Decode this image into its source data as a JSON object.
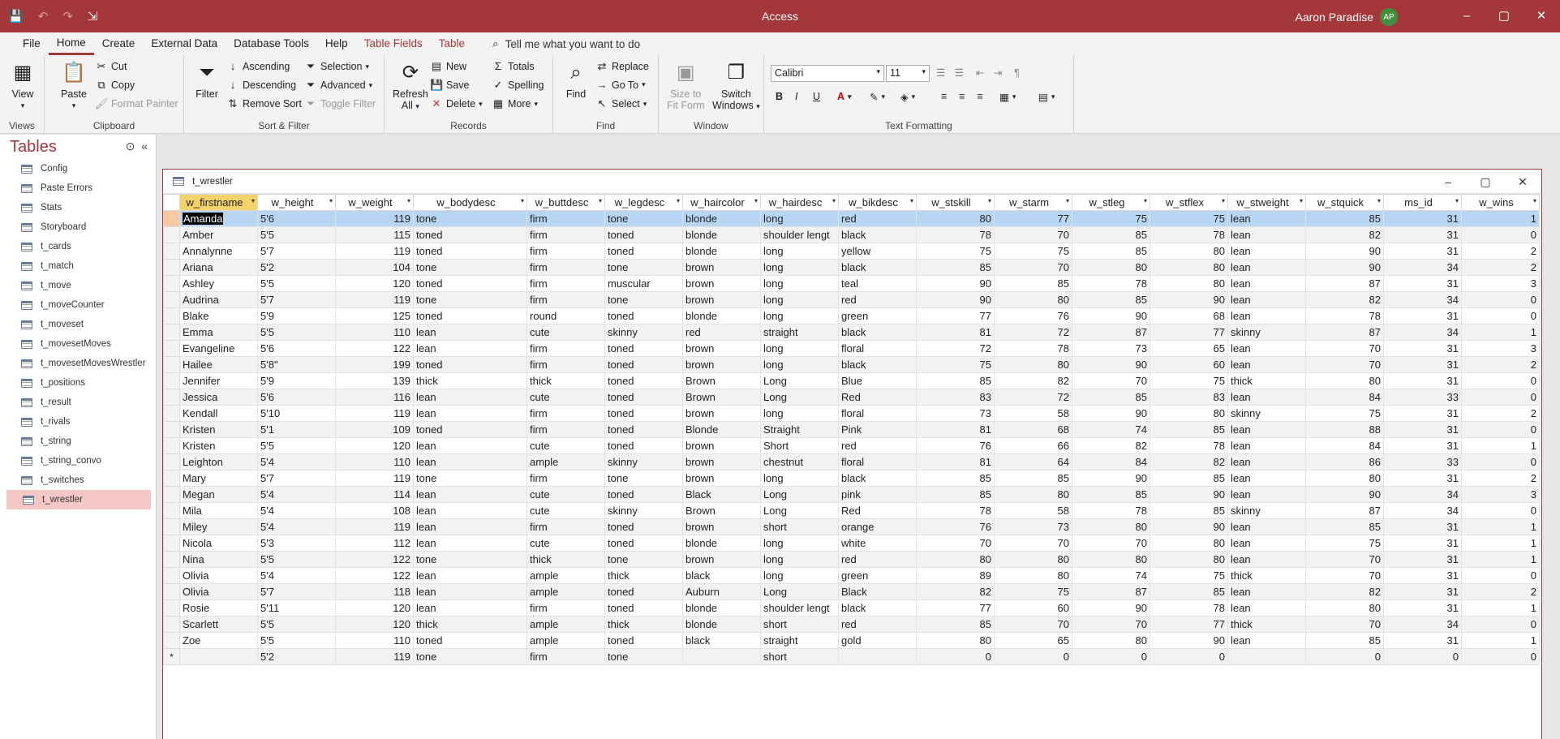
{
  "titlebar": {
    "qat": {
      "save": "💾",
      "undo": "↶",
      "redo": "↷",
      "customize": "⇲"
    },
    "title": "Access",
    "user": "Aaron Paradise",
    "initials": "AP",
    "controls": {
      "minimize": "–",
      "maximize": "▢",
      "close": "✕"
    }
  },
  "menu": {
    "tabs": [
      "File",
      "Home",
      "Create",
      "External Data",
      "Database Tools",
      "Help",
      "Table Fields",
      "Table"
    ],
    "active": "Home",
    "search_icon": "⌕",
    "search": "Tell me what you want to do"
  },
  "ribbon": {
    "views": {
      "view": "View",
      "label": "Views"
    },
    "clipboard": {
      "paste": "Paste",
      "cut": "Cut",
      "copy": "Copy",
      "format_painter": "Format Painter",
      "label": "Clipboard"
    },
    "sortfilter": {
      "filter": "Filter",
      "ascending": "Ascending",
      "descending": "Descending",
      "remove_sort": "Remove Sort",
      "selection": "Selection",
      "advanced": "Advanced",
      "toggle_filter": "Toggle Filter",
      "label": "Sort & Filter"
    },
    "records": {
      "refresh": "Refresh",
      "refresh2": "All",
      "new": "New",
      "save": "Save",
      "delete": "Delete",
      "totals": "Totals",
      "spelling": "Spelling",
      "more": "More",
      "label": "Records"
    },
    "find": {
      "find": "Find",
      "replace": "Replace",
      "goto": "Go To",
      "select": "Select",
      "label": "Find"
    },
    "window": {
      "size_to_fit": "Size to",
      "size_to_fit2": "Fit Form",
      "switch": "Switch",
      "switch2": "Windows",
      "label": "Window"
    },
    "text": {
      "font": "Calibri",
      "size": "11",
      "bold": "B",
      "italic": "I",
      "underline": "U",
      "label": "Text Formatting"
    }
  },
  "nav": {
    "title": "Tables",
    "items": [
      "Config",
      "Paste Errors",
      "Stats",
      "Storyboard",
      "t_cards",
      "t_match",
      "t_move",
      "t_moveCounter",
      "t_moveset",
      "t_movesetMoves",
      "t_movesetMovesWrestler",
      "t_positions",
      "t_result",
      "t_rivals",
      "t_string",
      "t_string_convo",
      "t_switches",
      "t_wrestler"
    ],
    "selected": "t_wrestler"
  },
  "doc": {
    "title": "t_wrestler",
    "columns": [
      "w_firstname",
      "w_height",
      "w_weight",
      "w_bodydesc",
      "w_buttdesc",
      "w_legdesc",
      "w_haircolor",
      "w_hairdesc",
      "w_bikdesc",
      "w_stskill",
      "w_starm",
      "w_stleg",
      "w_stflex",
      "w_stweight",
      "w_stquick",
      "ms_id",
      "w_wins"
    ],
    "rows": [
      [
        "Amanda",
        "5'6",
        "119",
        "tone",
        "firm",
        "tone",
        "blonde",
        "long",
        "red",
        "80",
        "77",
        "75",
        "75",
        "lean",
        "85",
        "31",
        "1"
      ],
      [
        "Amber",
        "5'5",
        "115",
        "toned",
        "firm",
        "toned",
        "blonde",
        "shoulder lengt",
        "black",
        "78",
        "70",
        "85",
        "78",
        "lean",
        "82",
        "31",
        "0"
      ],
      [
        "Annalynne",
        "5'7",
        "119",
        "toned",
        "firm",
        "toned",
        "blonde",
        "long",
        "yellow",
        "75",
        "75",
        "85",
        "80",
        "lean",
        "90",
        "31",
        "2"
      ],
      [
        "Ariana",
        "5'2",
        "104",
        "tone",
        "firm",
        "tone",
        "brown",
        "long",
        "black",
        "85",
        "70",
        "80",
        "80",
        "lean",
        "90",
        "34",
        "2"
      ],
      [
        "Ashley",
        "5'5",
        "120",
        "toned",
        "firm",
        "muscular",
        "brown",
        "long",
        "teal",
        "90",
        "85",
        "78",
        "80",
        "lean",
        "87",
        "31",
        "3"
      ],
      [
        "Audrina",
        "5'7",
        "119",
        "tone",
        "firm",
        "tone",
        "brown",
        "long",
        "red",
        "90",
        "80",
        "85",
        "90",
        "lean",
        "82",
        "34",
        "0"
      ],
      [
        "Blake",
        "5'9",
        "125",
        "toned",
        "round",
        "toned",
        "blonde",
        "long",
        "green",
        "77",
        "76",
        "90",
        "68",
        "lean",
        "78",
        "31",
        "0"
      ],
      [
        "Emma",
        "5'5",
        "110",
        "lean",
        "cute",
        "skinny",
        "red",
        "straight",
        "black",
        "81",
        "72",
        "87",
        "77",
        "skinny",
        "87",
        "34",
        "1"
      ],
      [
        "Evangeline",
        "5'6",
        "122",
        "lean",
        "firm",
        "toned",
        "brown",
        "long",
        "floral",
        "72",
        "78",
        "73",
        "65",
        "lean",
        "70",
        "31",
        "3"
      ],
      [
        "Hailee",
        "5'8\"",
        "199",
        "toned",
        "firm",
        "toned",
        "brown",
        "long",
        "black",
        "75",
        "80",
        "90",
        "60",
        "lean",
        "70",
        "31",
        "2"
      ],
      [
        "Jennifer",
        "5'9",
        "139",
        "thick",
        "thick",
        "toned",
        "Brown",
        "Long",
        "Blue",
        "85",
        "82",
        "70",
        "75",
        "thick",
        "80",
        "31",
        "0"
      ],
      [
        "Jessica",
        "5'6",
        "116",
        "lean",
        "cute",
        "toned",
        "Brown",
        "Long",
        "Red",
        "83",
        "72",
        "85",
        "83",
        "lean",
        "84",
        "33",
        "0"
      ],
      [
        "Kendall",
        "5'10",
        "119",
        "lean",
        "firm",
        "toned",
        "brown",
        "long",
        "floral",
        "73",
        "58",
        "90",
        "80",
        "skinny",
        "75",
        "31",
        "2"
      ],
      [
        "Kristen",
        "5'1",
        "109",
        "toned",
        "firm",
        "toned",
        "Blonde",
        "Straight",
        "Pink",
        "81",
        "68",
        "74",
        "85",
        "lean",
        "88",
        "31",
        "0"
      ],
      [
        "Kristen",
        "5'5",
        "120",
        "lean",
        "cute",
        "toned",
        "brown",
        "Short",
        "red",
        "76",
        "66",
        "82",
        "78",
        "lean",
        "84",
        "31",
        "1"
      ],
      [
        "Leighton",
        "5'4",
        "110",
        "lean",
        "ample",
        "skinny",
        "brown",
        "chestnut",
        "floral",
        "81",
        "64",
        "84",
        "82",
        "lean",
        "86",
        "33",
        "0"
      ],
      [
        "Mary",
        "5'7",
        "119",
        "tone",
        "firm",
        "tone",
        "brown",
        "long",
        "black",
        "85",
        "85",
        "90",
        "85",
        "lean",
        "80",
        "31",
        "2"
      ],
      [
        "Megan",
        "5'4",
        "114",
        "lean",
        "cute",
        "toned",
        "Black",
        "Long",
        "pink",
        "85",
        "80",
        "85",
        "90",
        "lean",
        "90",
        "34",
        "3"
      ],
      [
        "Mila",
        "5'4",
        "108",
        "lean",
        "cute",
        "skinny",
        "Brown",
        "Long",
        "Red",
        "78",
        "58",
        "78",
        "85",
        "skinny",
        "87",
        "34",
        "0"
      ],
      [
        "Miley",
        "5'4",
        "119",
        "lean",
        "firm",
        "toned",
        "brown",
        "short",
        "orange",
        "76",
        "73",
        "80",
        "90",
        "lean",
        "85",
        "31",
        "1"
      ],
      [
        "Nicola",
        "5'3",
        "112",
        "lean",
        "cute",
        "toned",
        "blonde",
        "long",
        "white",
        "70",
        "70",
        "70",
        "80",
        "lean",
        "75",
        "31",
        "1"
      ],
      [
        "Nina",
        "5'5",
        "122",
        "tone",
        "thick",
        "tone",
        "brown",
        "long",
        "red",
        "80",
        "80",
        "80",
        "80",
        "lean",
        "70",
        "31",
        "1"
      ],
      [
        "Olivia",
        "5'4",
        "122",
        "lean",
        "ample",
        "thick",
        "black",
        "long",
        "green",
        "89",
        "80",
        "74",
        "75",
        "thick",
        "70",
        "31",
        "0"
      ],
      [
        "Olivia",
        "5'7",
        "118",
        "lean",
        "ample",
        "toned",
        "Auburn",
        "Long",
        "Black",
        "82",
        "75",
        "87",
        "85",
        "lean",
        "82",
        "31",
        "2"
      ],
      [
        "Rosie",
        "5'11",
        "120",
        "lean",
        "firm",
        "toned",
        "blonde",
        "shoulder lengt",
        "black",
        "77",
        "60",
        "90",
        "78",
        "lean",
        "80",
        "31",
        "1"
      ],
      [
        "Scarlett",
        "5'5",
        "120",
        "thick",
        "ample",
        "thick",
        "blonde",
        "short",
        "red",
        "85",
        "70",
        "70",
        "77",
        "thick",
        "70",
        "34",
        "0"
      ],
      [
        "Zoe",
        "5'5",
        "110",
        "toned",
        "ample",
        "toned",
        "black",
        "straight",
        "gold",
        "80",
        "65",
        "80",
        "90",
        "lean",
        "85",
        "31",
        "1"
      ]
    ],
    "new_row": [
      "",
      "5'2",
      "119",
      "tone",
      "firm",
      "tone",
      "",
      "short",
      "",
      "0",
      "0",
      "0",
      "0",
      "",
      "0",
      "0",
      "0"
    ],
    "new_marker": "*"
  }
}
